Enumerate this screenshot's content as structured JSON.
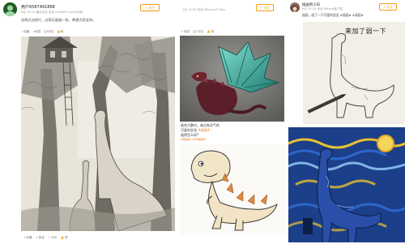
{
  "post1": {
    "username": "用户6587491868",
    "meta": "6月 14:15 最近评论 来自 HUAWEI nova3手机",
    "text": "这两天比较忙，过两天画画一张，希望大家支持。",
    "follow_label": "+ 关注",
    "actions": [
      "☆收藏",
      "↗转发",
      "💬评论",
      "👍赞"
    ],
    "bottom_actions": [
      "⭳ 收藏",
      "↗ 转发",
      "☆ 评论",
      "👍 赞"
    ]
  },
  "post2": {
    "meta": "1日 14:35 来自 iPhone XS Max",
    "follow_label": "+ 关注",
    "actions": [
      "↗ 转发",
      "💬 评论",
      "👍 赞"
    ],
    "caption_line1": "画完大鹏鸟，来点有灵气的",
    "caption_line2": "可爱的恐龙 ",
    "caption_tag": "#插画#",
    "caption_line3": "画得怎么样?",
    "caption_hash": "#插画# #手绘画#"
  },
  "post3": {
    "username": "插画师小白",
    "meta": "6月 15:20 来自 iPhone客户端",
    "text": "插画，画了一只可爱的恐龙 #插画# #画画# ",
    "follow_label": "+ 关注",
    "hand_text": "来加了弱一下"
  },
  "colors": {
    "accent": "#f39c12",
    "link": "#e67e22",
    "sketch_bg": "#f3f1ea",
    "starry_blue": "#1c3f8a",
    "starry_yellow": "#e8c030"
  }
}
